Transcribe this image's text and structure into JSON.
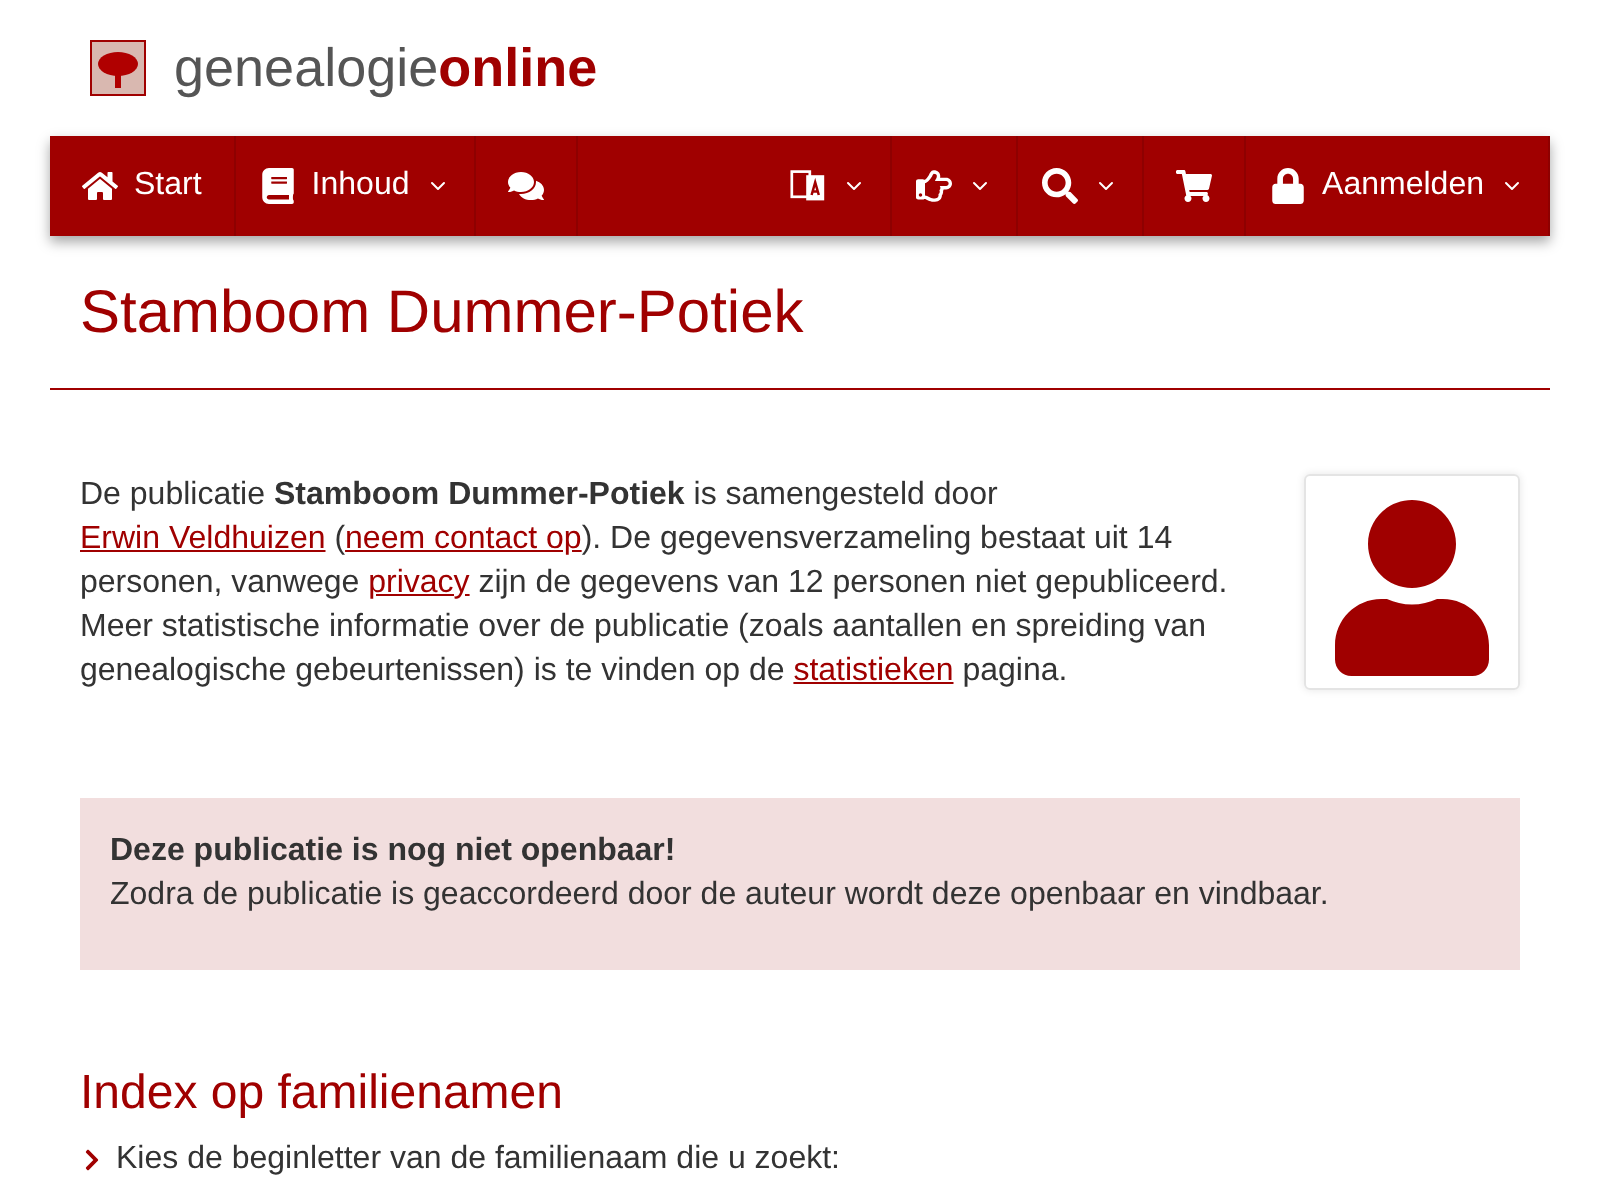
{
  "logo": {
    "plain": "genealogie",
    "bold": "online"
  },
  "nav": [
    {
      "kind": "home",
      "label": "Start",
      "dropdown": false
    },
    {
      "kind": "book",
      "label": "Inhoud",
      "dropdown": true
    },
    {
      "kind": "chat",
      "dropdown": false
    },
    {
      "kind": "spacer"
    },
    {
      "kind": "translate",
      "dropdown": true
    },
    {
      "kind": "hand",
      "dropdown": true
    },
    {
      "kind": "search",
      "dropdown": true
    },
    {
      "kind": "cart",
      "dropdown": false
    },
    {
      "kind": "lock",
      "label": "Aanmelden",
      "dropdown": true
    }
  ],
  "title": "Stamboom Dummer-Potiek",
  "intro": [
    {
      "kind": "text",
      "text": "De publicatie **Stamboom Dummer-Potiek** is samengesteld door "
    },
    {
      "kind": "link",
      "text": "Erwin Veldhuizen"
    },
    {
      "kind": "text",
      "text": " ("
    },
    {
      "kind": "link",
      "text": "neem contact op"
    },
    {
      "kind": "text",
      "text": "). De gegevensverzameling bestaat uit 14 personen, vanwege "
    },
    {
      "kind": "link",
      "text": "privacy"
    },
    {
      "kind": "text",
      "text": " zijn de gegevens van 12 personen niet gepubliceerd. Meer statistische informatie over de publicatie (zoals aantallen en spreiding van genealogische gebeurtenissen) is te vinden op de "
    },
    {
      "kind": "link",
      "text": "statistieken"
    },
    {
      "kind": "text",
      "text": " pagina."
    }
  ],
  "alert": {
    "heading": "Deze publicatie is nog niet openbaar!",
    "text": "Zodra de publicatie is geaccordeerd door de auteur wordt deze openbaar en vindbaar."
  },
  "index": {
    "heading": "Index op familienamen",
    "items": [
      "Kies de beginletter van de familienaam die u zoekt:"
    ]
  }
}
